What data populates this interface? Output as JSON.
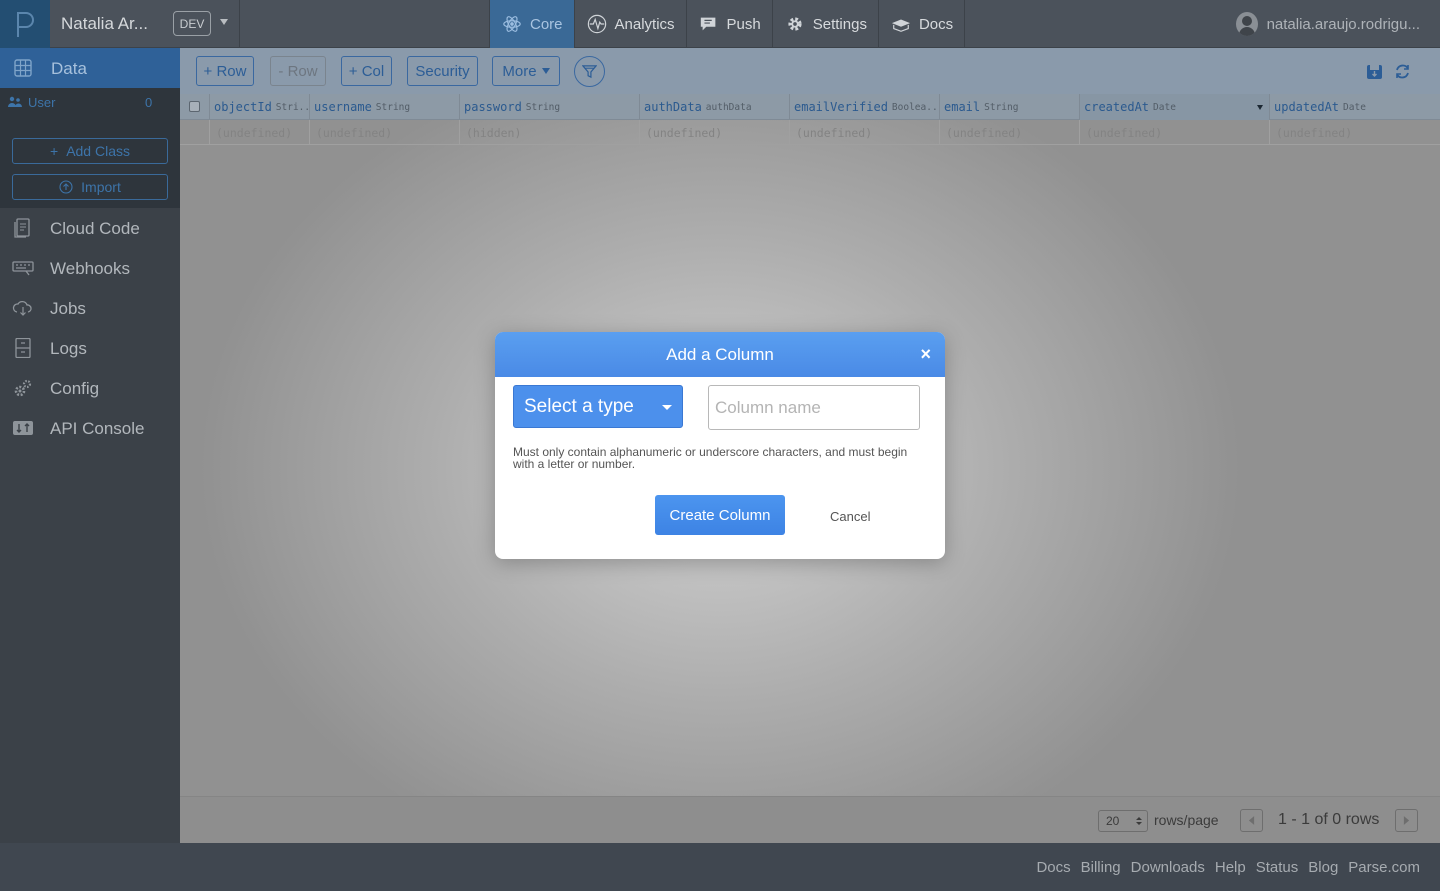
{
  "topbar": {
    "app_name": "Natalia Ar...",
    "env": "DEV",
    "nav": [
      {
        "label": "Core",
        "icon": "atom-icon",
        "active": true
      },
      {
        "label": "Analytics",
        "icon": "pulse-icon",
        "active": false
      },
      {
        "label": "Push",
        "icon": "chat-bubble-icon",
        "active": false
      },
      {
        "label": "Settings",
        "icon": "gear-icon",
        "active": false
      },
      {
        "label": "Docs",
        "icon": "book-icon",
        "active": false
      }
    ],
    "user": "natalia.araujo.rodrigu..."
  },
  "sidebar": {
    "data_label": "Data",
    "classes": [
      {
        "name": "User",
        "count": "0"
      }
    ],
    "add_class": "Add Class",
    "import": "Import",
    "items": [
      {
        "label": "Cloud Code",
        "icon": "file-code-icon"
      },
      {
        "label": "Webhooks",
        "icon": "webhook-icon"
      },
      {
        "label": "Jobs",
        "icon": "cloud-icon"
      },
      {
        "label": "Logs",
        "icon": "cabinet-icon"
      },
      {
        "label": "Config",
        "icon": "gears-icon"
      },
      {
        "label": "API Console",
        "icon": "console-icon"
      }
    ]
  },
  "toolbar": {
    "add_row": "+ Row",
    "remove_row": "- Row",
    "add_col": "+ Col",
    "security": "Security",
    "more": "More"
  },
  "table": {
    "columns": [
      {
        "name": "objectId",
        "type": "Stri..."
      },
      {
        "name": "username",
        "type": "String"
      },
      {
        "name": "password",
        "type": "String"
      },
      {
        "name": "authData",
        "type": "authData"
      },
      {
        "name": "emailVerified",
        "type": "Boolea..."
      },
      {
        "name": "email",
        "type": "String"
      },
      {
        "name": "createdAt",
        "type": "Date"
      },
      {
        "name": "updatedAt",
        "type": "Date"
      }
    ],
    "row": [
      "(undefined)",
      "(undefined)",
      "(hidden)",
      "(undefined)",
      "(undefined)",
      "(undefined)",
      "(undefined)",
      "(undefined)"
    ]
  },
  "pagination": {
    "per_page": "20",
    "per_page_label": "rows/page",
    "range": "1 - 1 of 0 rows"
  },
  "footer": {
    "links": [
      "Docs",
      "Billing",
      "Downloads",
      "Help",
      "Status",
      "Blog",
      "Parse.com"
    ]
  },
  "modal": {
    "title": "Add a Column",
    "close": "×",
    "type_select": "Select a type",
    "name_placeholder": "Column name",
    "hint": "Must only contain alphanumeric or underscore characters, and must begin with a letter or number.",
    "create": "Create Column",
    "cancel": "Cancel"
  },
  "colors": {
    "accent": "#4a8ae6",
    "active_nav": "#3a6996",
    "sidebar": "#3b4148"
  }
}
